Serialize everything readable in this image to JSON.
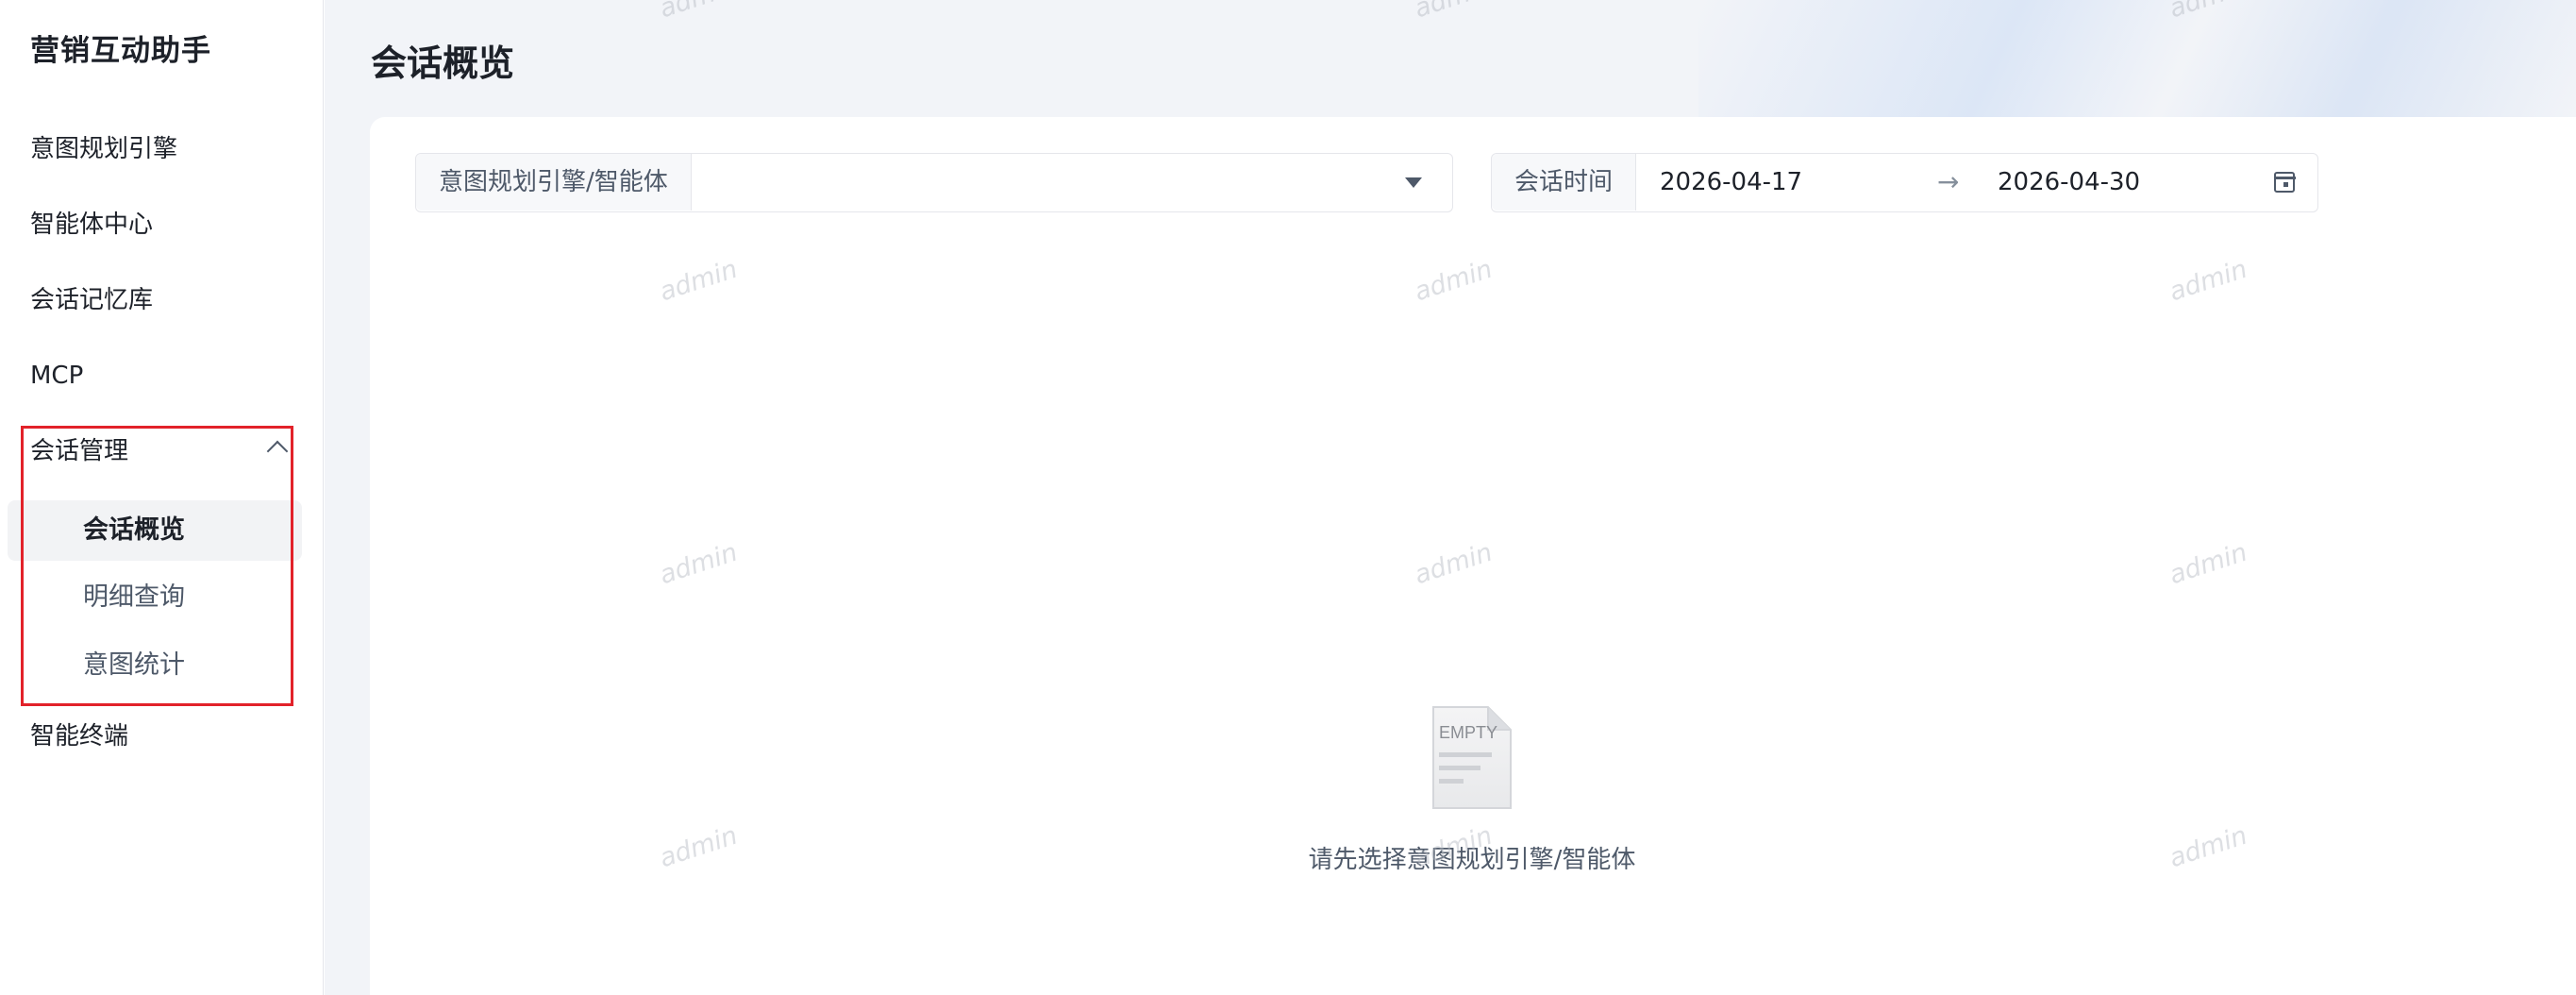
{
  "app": {
    "title": "营销互动助手"
  },
  "sidebar": {
    "items": [
      {
        "label": "意图规划引擎"
      },
      {
        "label": "智能体中心"
      },
      {
        "label": "会话记忆库"
      },
      {
        "label": "MCP"
      }
    ],
    "group": {
      "label": "会话管理",
      "expanded": true,
      "children": [
        {
          "label": "会话概览",
          "active": true
        },
        {
          "label": "明细查询"
        },
        {
          "label": "意图统计"
        }
      ]
    },
    "after_items": [
      {
        "label": "智能终端"
      }
    ]
  },
  "page": {
    "title": "会话概览"
  },
  "filters": {
    "engine": {
      "label": "意图规划引擎/智能体",
      "value": ""
    },
    "date": {
      "label": "会话时间",
      "start": "2026-04-17",
      "separator": "→",
      "end": "2026-04-30"
    }
  },
  "empty_state": {
    "icon_text": "EMPTY",
    "message": "请先选择意图规划引擎/智能体"
  },
  "watermark": {
    "text": "admin"
  },
  "colors": {
    "highlight_border": "#e2222a",
    "active_bg": "#f2f3f5",
    "page_bg": "#f2f4f8"
  },
  "icons": [
    "chevron-up-icon",
    "caret-down-icon",
    "calendar-icon",
    "empty-document-icon"
  ]
}
